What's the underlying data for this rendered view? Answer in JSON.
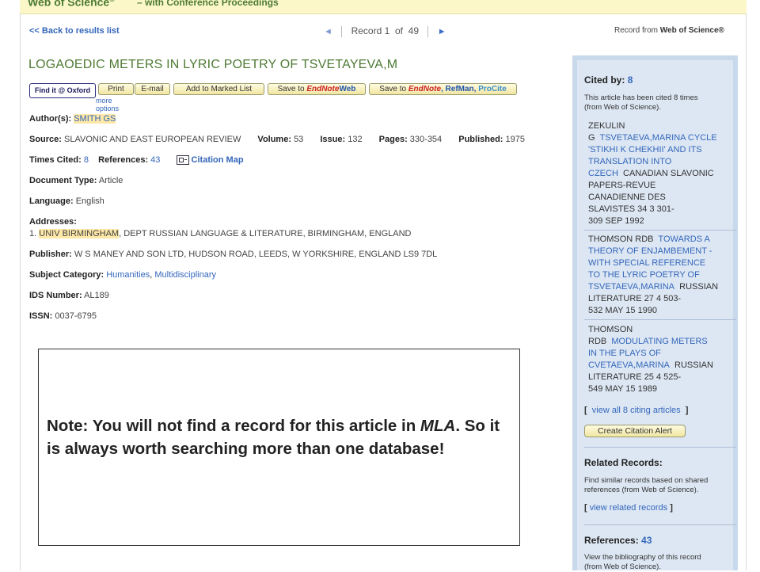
{
  "header": {
    "brand": "Web of Science",
    "brand_mark": "®",
    "subtitle": "– with Conference Proceedings"
  },
  "nav": {
    "back_link": "<< Back to results list",
    "prev_arrow": "◄",
    "record_label": "Record",
    "record_current": "1",
    "record_of": "of",
    "record_total": "49",
    "next_arrow": "►",
    "record_from_label": "Record from",
    "record_from_source": "Web of Science®"
  },
  "record": {
    "title": "LOGAOEDIC METERS IN LYRIC POETRY OF TSVETAYEVA,M",
    "toolbar": {
      "find_it": "Find it @ Oxford",
      "more_options": "more options",
      "print": "Print",
      "email": "E-mail",
      "add_marked": "Add to Marked List",
      "save_endnote_web_prefix": "Save to",
      "save_endnote_web_brand": "EndNote",
      "save_endnote_web_suffix": "Web",
      "save_endnote_prefix": "Save to",
      "save_endnote_brand": "EndNote",
      "save_endnote_refman": ", RefMan,",
      "save_endnote_procite": "ProCite"
    },
    "authors_label": "Author(s):",
    "authors_value": "SMITH GS",
    "source_label": "Source:",
    "source_value": "SLAVONIC AND EAST EUROPEAN REVIEW",
    "volume_label": "Volume:",
    "volume_value": "53",
    "issue_label": "Issue:",
    "issue_value": "132",
    "pages_label": "Pages:",
    "pages_value": "330-354",
    "published_label": "Published:",
    "published_value": "1975",
    "times_cited_label": "Times Cited:",
    "times_cited_value": "8",
    "references_label": "References:",
    "references_value": "43",
    "citation_map": "Citation Map",
    "doctype_label": "Document Type:",
    "doctype_value": "Article",
    "language_label": "Language:",
    "language_value": "English",
    "addresses_label": "Addresses:",
    "address_num": "1.",
    "address_highlight": "UNIV BIRMINGHAM",
    "address_rest": ", DEPT RUSSIAN LANGUAGE & LITERATURE, BIRMINGHAM, ENGLAND",
    "publisher_label": "Publisher:",
    "publisher_value": "W S MANEY AND SON LTD, HUDSON ROAD, LEEDS, W YORKSHIRE, ENGLAND LS9 7DL",
    "subject_label": "Subject Category:",
    "subject_value_1": "Humanities",
    "subject_value_2": "Multidisciplinary",
    "ids_label": "IDS Number:",
    "ids_value": "AL189",
    "issn_label": "ISSN:",
    "issn_value": "0037-6795"
  },
  "sidebar": {
    "cited_by_label": "Cited by:",
    "cited_by_count": "8",
    "cited_by_desc_1": "This article has been cited 8 times",
    "cited_by_desc_2": "(from Web of Science).",
    "refs": [
      {
        "l1": "ZEKULIN",
        "l2a": "G",
        "l2b": "TSVETAEVA,MARINA CYCLE",
        "l3": "'STIKHI K CHEKHII' AND ITS",
        "l4": "TRANSLATION INTO",
        "l5a": "CZECH",
        "l5b": "CANADIAN SLAVONIC",
        "l6": "PAPERS-REVUE",
        "l7": "CANADIENNE DES",
        "l8": "SLAVISTES 34 3 301-",
        "l9": "309 SEP 1992"
      },
      {
        "l1a": "THOMSON RDB",
        "l1b": "TOWARDS A",
        "l2": "THEORY OF ENJAMBEMENT -",
        "l3": "WITH SPECIAL REFERENCE",
        "l4": "TO THE LYRIC POETRY OF",
        "l5a": "TSVETAEVA,MARINA",
        "l5b": "RUSSIAN",
        "l6": "LITERATURE 27 4 503-",
        "l7": "532 MAY 15 1990"
      },
      {
        "l1": "THOMSON",
        "l2a": "RDB",
        "l2b": "MODULATING METERS",
        "l3": "IN THE PLAYS OF",
        "l4a": "CVETAEVA,MARINA",
        "l4b": "RUSSIAN",
        "l5": "LITERATURE 25 4 525-",
        "l6": "549 MAY 15 1989"
      }
    ],
    "view_all_open": "[",
    "view_all_link": "view all 8 citing articles",
    "view_all_close": "]",
    "create_alert": "Create Citation Alert",
    "related_label": "Related Records:",
    "related_desc_1": "Find similar records based on shared",
    "related_desc_2": "references (from Web of Science).",
    "related_open": "[",
    "related_link": "view related records",
    "related_close": "]",
    "references_label": "References:",
    "references_count": "43",
    "references_desc_1": "View the bibliography of this record",
    "references_desc_2": "(from Web of Science)."
  },
  "note": {
    "prefix": "Note:  You will not find a record for this article in ",
    "italic": "MLA",
    "suffix": ". So it is always worth searching more than one database!"
  }
}
